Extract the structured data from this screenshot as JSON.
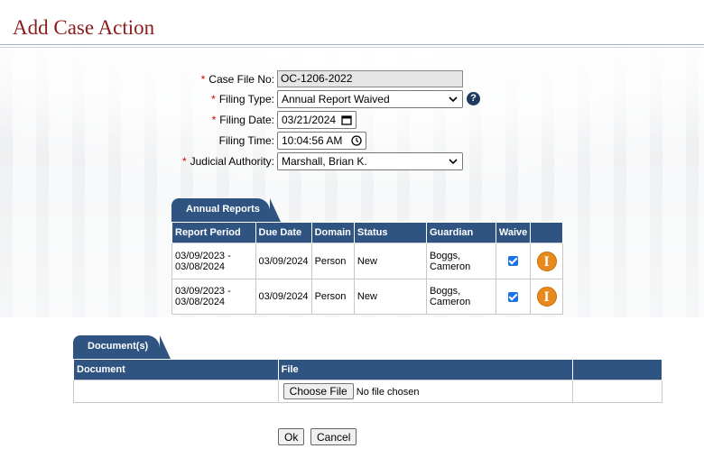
{
  "page": {
    "title": "Add Case Action"
  },
  "form": {
    "case_file_no": {
      "label": "Case File No:",
      "required": "*",
      "value": "OC-1206-2022"
    },
    "filing_type": {
      "label": "Filing Type:",
      "required": "*",
      "value": "Annual Report Waived",
      "help": "?"
    },
    "filing_date": {
      "label": "Filing Date:",
      "required": "*",
      "value": "03/21/2024"
    },
    "filing_time": {
      "label": "Filing Time:",
      "value": "10:04:56 AM"
    },
    "judicial_authority": {
      "label": "Judicial Authority:",
      "required": "*",
      "value": "Marshall, Brian K."
    }
  },
  "annual_reports": {
    "tab_label": "Annual Reports",
    "columns": [
      "Report Period",
      "Due Date",
      "Domain",
      "Status",
      "Guardian",
      "Waive"
    ],
    "rows": [
      {
        "period_start": "03/09/2023 -",
        "period_end": "03/08/2024",
        "due_date": "03/09/2024",
        "domain": "Person",
        "status": "New",
        "guardian_last": "Boggs,",
        "guardian_first": "Cameron",
        "waive": true,
        "info": "I"
      },
      {
        "period_start": "03/09/2023 -",
        "period_end": "03/08/2024",
        "due_date": "03/09/2024",
        "domain": "Person",
        "status": "New",
        "guardian_last": "Boggs,",
        "guardian_first": "Cameron",
        "waive": true,
        "info": "I"
      }
    ]
  },
  "documents": {
    "tab_label": "Document(s)",
    "columns": [
      "Document",
      "File"
    ],
    "choose_file_label": "Choose File",
    "no_file_text": "No file chosen"
  },
  "actions": {
    "ok_label": "Ok",
    "cancel_label": "Cancel"
  },
  "colors": {
    "title": "#8b1a1a",
    "header": "#2f5482",
    "info_icon": "#e8891d",
    "required": "#d00000"
  },
  "icons": {
    "help": "question-circle-icon",
    "calendar": "calendar-icon",
    "clock": "clock-icon",
    "dropdown": "chevron-down-icon",
    "info": "info-icon",
    "checkbox": "checkbox-checked-icon"
  }
}
